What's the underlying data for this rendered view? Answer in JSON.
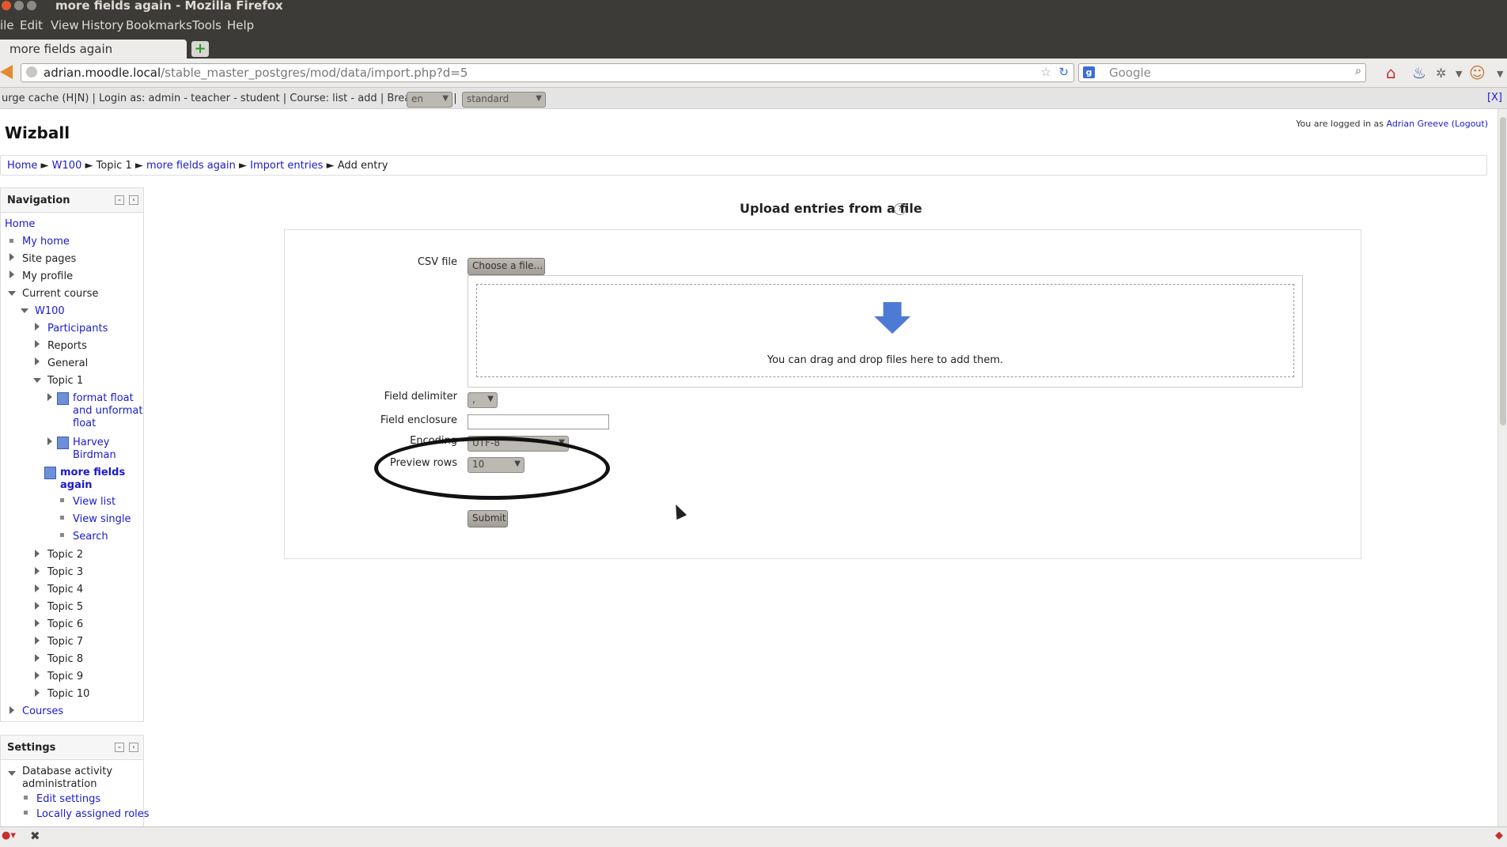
{
  "window": {
    "title": "more fields again - Mozilla Firefox"
  },
  "menu": [
    "ile",
    "Edit",
    "View",
    "History",
    "Bookmarks",
    "Tools",
    "Help"
  ],
  "tab": {
    "title": "more fields again"
  },
  "url": {
    "host": "adrian.moodle.local",
    "path": "/stable_master_postgres/mod/data/import.php?d=5"
  },
  "search": {
    "placeholder": "Google"
  },
  "devbar": {
    "text": "urge cache (H|N) | Login as: admin - teacher - student | Course: list - add | Breadcrumb |",
    "lang": "en",
    "theme": "standard",
    "close": "[X]"
  },
  "site": {
    "name": "Wizball"
  },
  "login": {
    "prefix": "You are logged in as ",
    "user": "Adrian Greeve",
    "logout": "(Logout)"
  },
  "breadcrumb": {
    "home": "Home",
    "course": "W100",
    "topic": "Topic 1",
    "activity": "more fields again",
    "import": "Import entries",
    "current": "Add entry",
    "sep": "►"
  },
  "nav": {
    "title": "Navigation",
    "home": "Home",
    "my_home": "My home",
    "site_pages": "Site pages",
    "my_profile": "My profile",
    "current_course": "Current course",
    "course": "W100",
    "participants": "Participants",
    "reports": "Reports",
    "general": "General",
    "topic1": "Topic 1",
    "db1a": "format float",
    "db1b": "and unformat",
    "db1c": "float",
    "db2a": "Harvey",
    "db2b": "Birdman",
    "db3a": "more fields",
    "db3b": "again",
    "view_list": "View list",
    "view_single": "View single",
    "search": "Search",
    "topics": [
      "Topic 2",
      "Topic 3",
      "Topic 4",
      "Topic 5",
      "Topic 6",
      "Topic 7",
      "Topic 8",
      "Topic 9",
      "Topic 10"
    ],
    "courses": "Courses"
  },
  "settings": {
    "title": "Settings",
    "admin_a": "Database activity",
    "admin_b": "administration",
    "edit": "Edit settings",
    "roles": "Locally assigned roles"
  },
  "form": {
    "title": "Upload entries from a file",
    "help": "?",
    "csv_label": "CSV file",
    "choose": "Choose a file...",
    "drop_text": "You can drag and drop files here to add them.",
    "delimiter_label": "Field delimiter",
    "delimiter_value": ",",
    "enclosure_label": "Field enclosure",
    "enclosure_value": "",
    "encoding_label": "Encoding",
    "encoding_value": "UTF-8",
    "preview_label": "Preview rows",
    "preview_value": "10",
    "submit": "Submit"
  },
  "colors": {
    "link": "#1a1acc",
    "chrome": "#3c3b37",
    "button": "#bdb8b1"
  }
}
